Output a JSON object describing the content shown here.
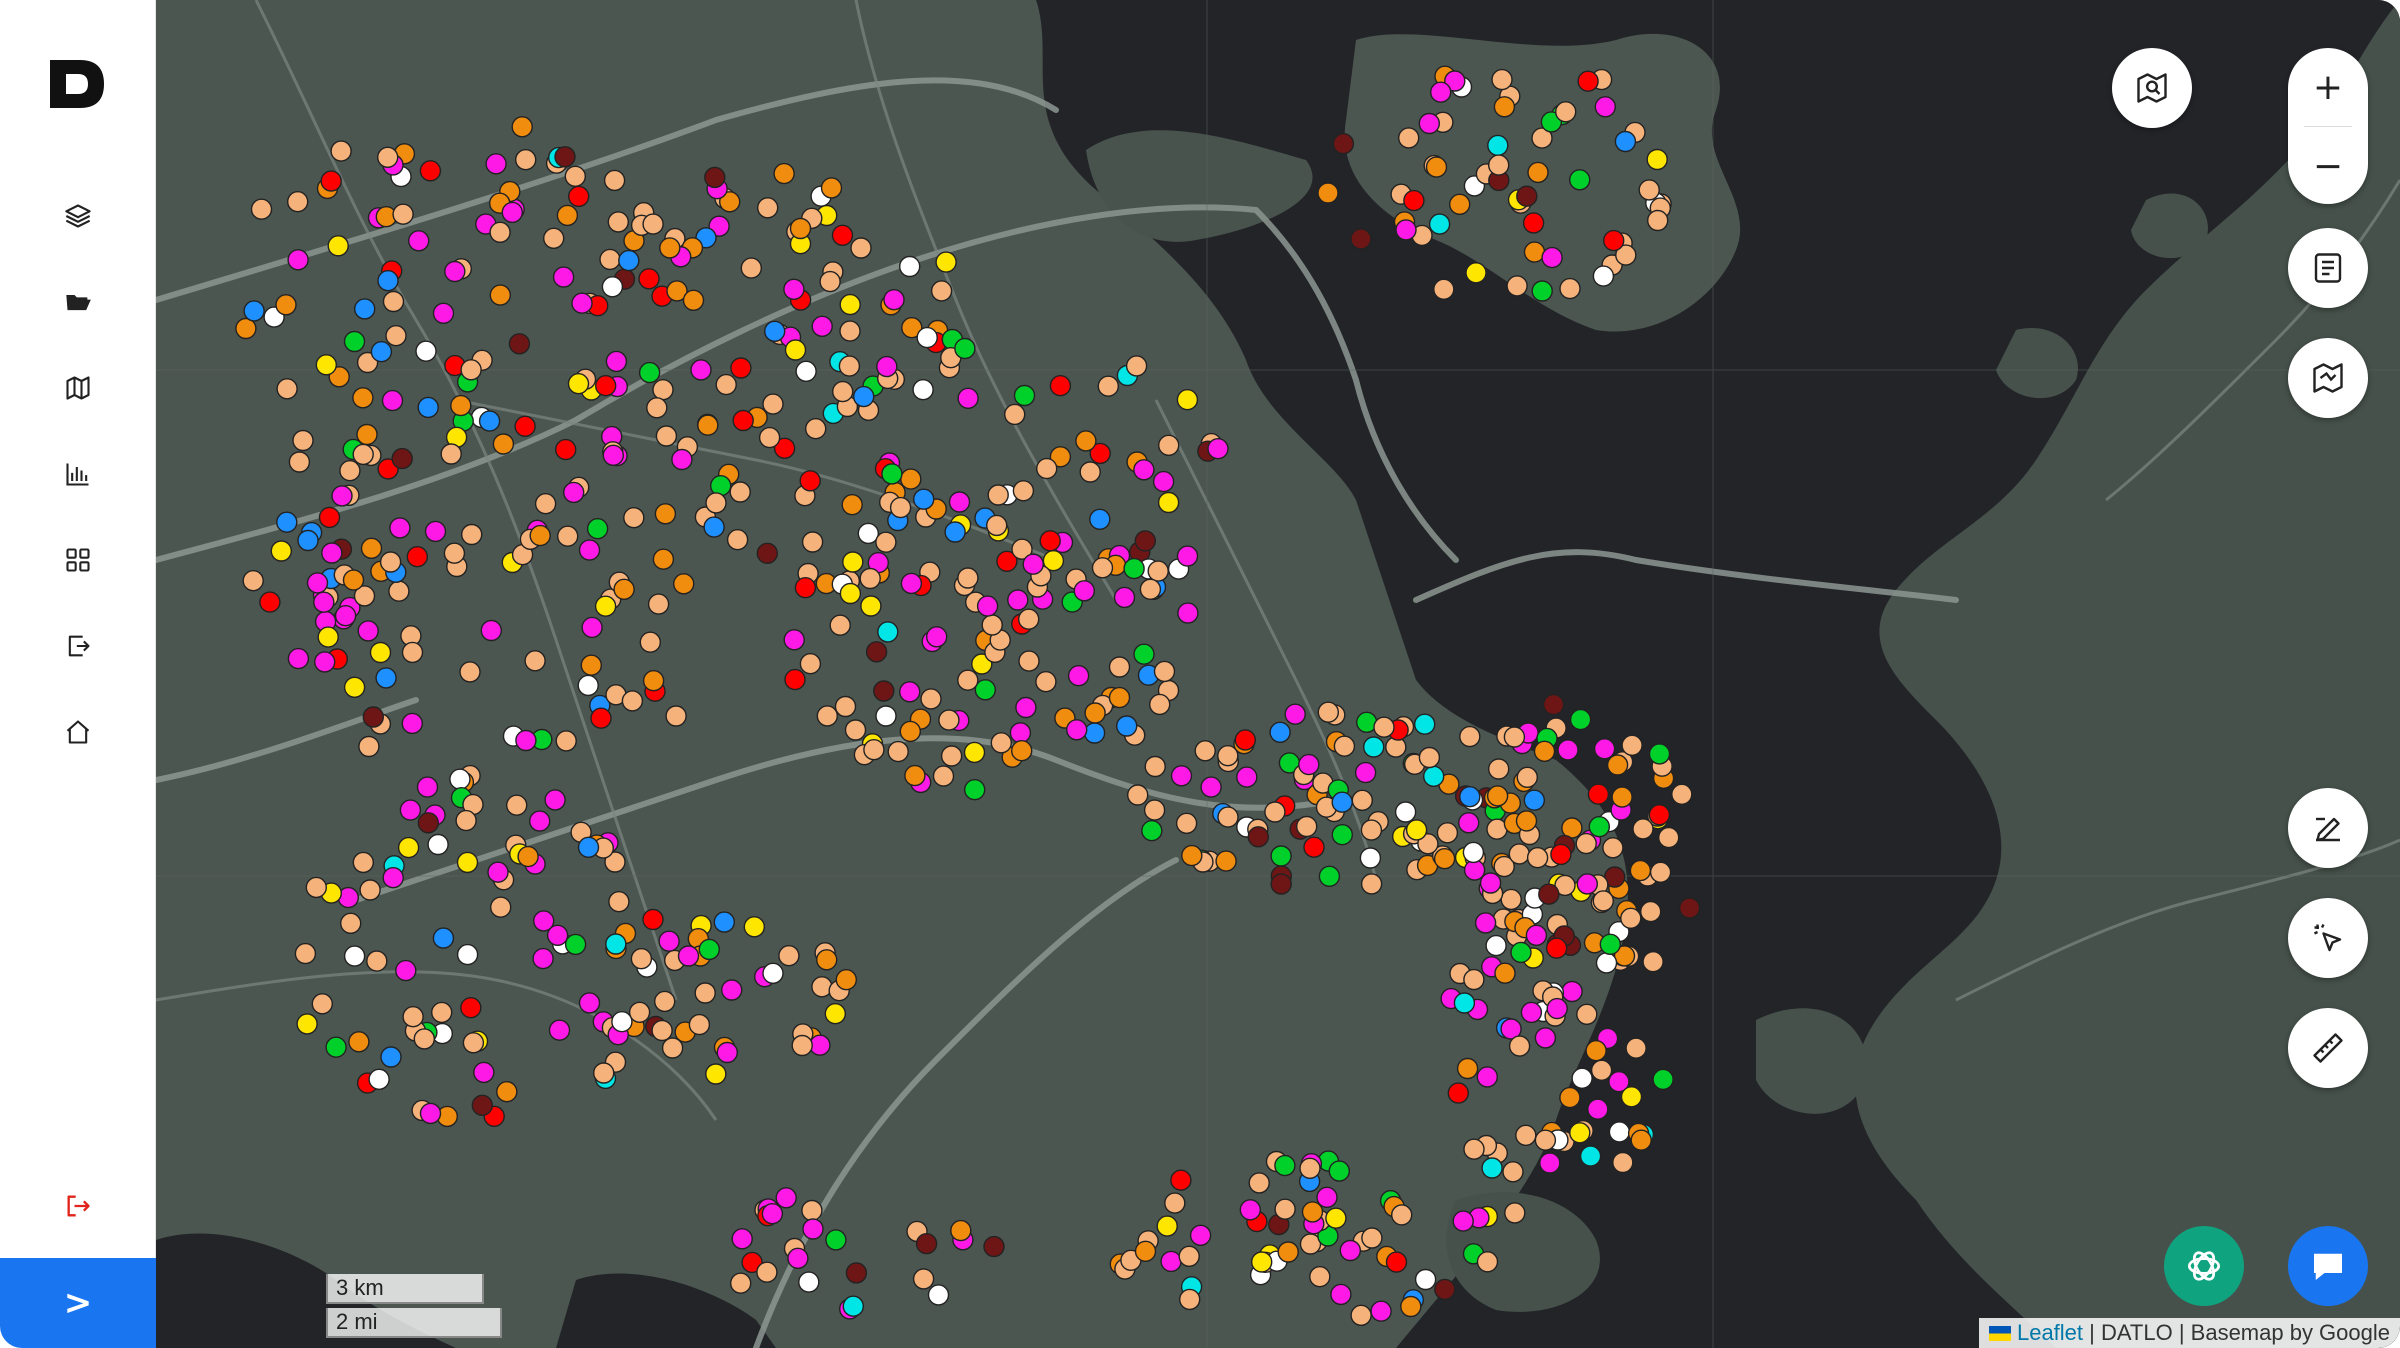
{
  "sidebar": {
    "logo_icon": "datlo-logo-icon",
    "items": [
      {
        "icon": "layers-icon"
      },
      {
        "icon": "folder-open-icon"
      },
      {
        "icon": "map-icon"
      },
      {
        "icon": "bar-chart-icon"
      },
      {
        "icon": "grid-icon"
      },
      {
        "icon": "export-icon"
      },
      {
        "icon": "home-icon"
      }
    ],
    "logout_icon": "logout-icon",
    "expand_label": ">"
  },
  "map_controls": {
    "zoom_in_label": "+",
    "zoom_out_label": "−",
    "tools": [
      "map-search-icon",
      "legend-list-icon",
      "map-area-icon",
      "draw-edit-icon",
      "select-pointer-icon",
      "ruler-icon"
    ]
  },
  "scale": {
    "metric": "3 km",
    "imperial": "2 mi"
  },
  "attribution": {
    "leaflet": "Leaflet",
    "sep1": " | ",
    "datlo": "DATLO",
    "sep2": " | ",
    "basemap": "Basemap by Google"
  },
  "colors": {
    "accent": "#1976f0",
    "chatgpt": "#10a37f",
    "water": "#222428",
    "land": "#4c5650",
    "marker_palette": [
      "#f5b27a",
      "#f08c0e",
      "#ff19e6",
      "#ff0000",
      "#6e1616",
      "#00d12a",
      "#ffffff",
      "#1e90ff",
      "#ffe600",
      "#00e5e5"
    ]
  }
}
